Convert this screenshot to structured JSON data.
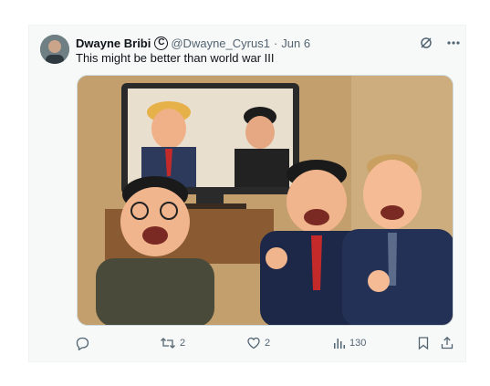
{
  "tweet": {
    "author_name": "Dwayne Bribi",
    "badge_icon": "copyright-circle-icon",
    "handle": "@Dwayne_Cyrus1",
    "separator": "·",
    "date": "Jun 6",
    "text": "This might be better than world war III",
    "media_alt": "Cartoon illustration"
  },
  "header_icons": [
    "grok-icon",
    "more-icon"
  ],
  "actions": {
    "reply": {
      "icon": "reply-icon",
      "count": ""
    },
    "repost": {
      "icon": "repost-icon",
      "count": "2"
    },
    "like": {
      "icon": "heart-icon",
      "count": "2"
    },
    "views": {
      "icon": "views-chart-icon",
      "count": "130"
    },
    "bookmark": {
      "icon": "bookmark-icon"
    },
    "share": {
      "icon": "share-icon"
    }
  },
  "colors": {
    "text": "#0f1419",
    "secondary": "#536471",
    "card_bg": "#f7f9f9",
    "border": "#cfd9de"
  }
}
